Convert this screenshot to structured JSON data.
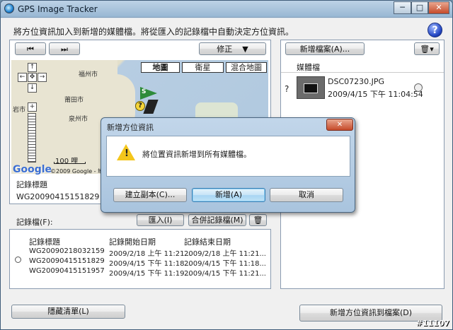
{
  "window": {
    "title": "GPS Image Tracker",
    "minimize": "─",
    "maximize": "□",
    "close": "✕"
  },
  "instruction": "將方位資訊加入到新增的媒體檔。將從匯入的記錄檔中自動決定方位資訊。",
  "help_label": "?",
  "map_toolbar": {
    "prev": "⏮",
    "next": "⏭",
    "correct_label": "修正",
    "correct_arrow": "▼"
  },
  "map": {
    "types": [
      "地圖",
      "衛星",
      "混合地圖"
    ],
    "active_type": "地圖",
    "city_labels": [
      "福州市",
      "莆田市",
      "泉州市",
      "岩市"
    ],
    "scale_label": "100 哩",
    "copyright": "©2009 Google - 地圖資料 ©2009 ©2009 Mapabc,AND,SK",
    "logo": "Google",
    "zoom_in": "+",
    "zoom_out": "−",
    "pan_up": "↑",
    "pan_down": "↓",
    "pan_left": "←",
    "pan_right": "→",
    "pan_center": "✥"
  },
  "track_info": {
    "header": "記錄標題",
    "value": "WG20090415151829"
  },
  "logs": {
    "label": "記錄檔(F):",
    "import_label": "匯入(I)",
    "merge_label": "合併記錄檔(M)",
    "columns": [
      "記錄標題",
      "記錄開始日期",
      "記錄結束日期"
    ],
    "rows": [
      {
        "title": "WG20090218032159",
        "start": "2009/2/18 上午 11:21...",
        "end": "2009/2/18 上午 11:21..."
      },
      {
        "title": "WG20090415151829",
        "start": "2009/4/15 下午 11:18...",
        "end": "2009/4/15 下午 11:18..."
      },
      {
        "title": "WG20090415151957",
        "start": "2009/4/15 下午 11:19...",
        "end": "2009/4/15 下午 11:21..."
      }
    ]
  },
  "media": {
    "add_label": "新增檔案(A)...",
    "header": "媒體檔",
    "item": {
      "marker": "?",
      "filename": "DSC07230.JPG",
      "date": "2009/4/15 下午 11:04:54"
    }
  },
  "bottom": {
    "hide_list": "隱藏清單(L)",
    "add_to_file": "新增方位資訊到檔案(D)"
  },
  "dialog": {
    "title": "新增方位資訊",
    "message": "將位置資訊新增到所有媒體檔。",
    "warn_mark": "!",
    "buttons": {
      "copy": "建立副本(C)...",
      "add": "新增(A)",
      "cancel": "取消"
    },
    "close": "✕"
  },
  "watermark": "#11107",
  "colors": {
    "accent": "#3c7fb1",
    "dialog_close": "#c54a2a",
    "warning": "#f4c61c"
  }
}
